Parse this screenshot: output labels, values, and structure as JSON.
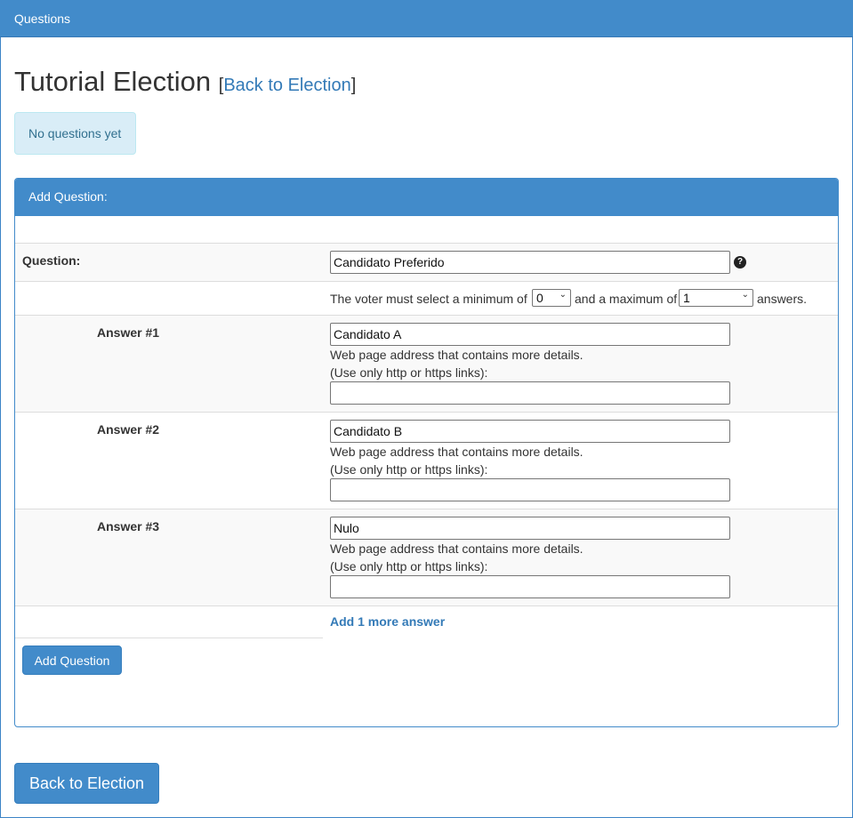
{
  "topbar": {
    "title": "Questions"
  },
  "heading": {
    "title": "Tutorial Election",
    "open_bracket": "[",
    "back_link": "Back to Election",
    "close_bracket": "]"
  },
  "alert": {
    "text": "No questions yet"
  },
  "panel": {
    "heading": "Add Question:",
    "question_label": "Question:",
    "question_value": "Candidato Preferido",
    "help_icon": "question-circle-icon",
    "constraint": {
      "prefix": "The voter must select a minimum of",
      "min_value": "0",
      "middle": "and a maximum of",
      "max_value": "1",
      "suffix": "answers."
    },
    "answers": [
      {
        "label": "Answer #1",
        "value": "Candidato A",
        "url_help1": "Web page address that contains more details.",
        "url_help2": "(Use only http or https links):",
        "url_value": ""
      },
      {
        "label": "Answer #2",
        "value": "Candidato B",
        "url_help1": "Web page address that contains more details.",
        "url_help2": "(Use only http or https links):",
        "url_value": ""
      },
      {
        "label": "Answer #3",
        "value": "Nulo",
        "url_help1": "Web page address that contains more details.",
        "url_help2": "(Use only http or https links):",
        "url_value": ""
      }
    ],
    "add_more_label": "Add 1 more answer",
    "add_question_button": "Add Question"
  },
  "footer": {
    "back_button": "Back to Election"
  }
}
